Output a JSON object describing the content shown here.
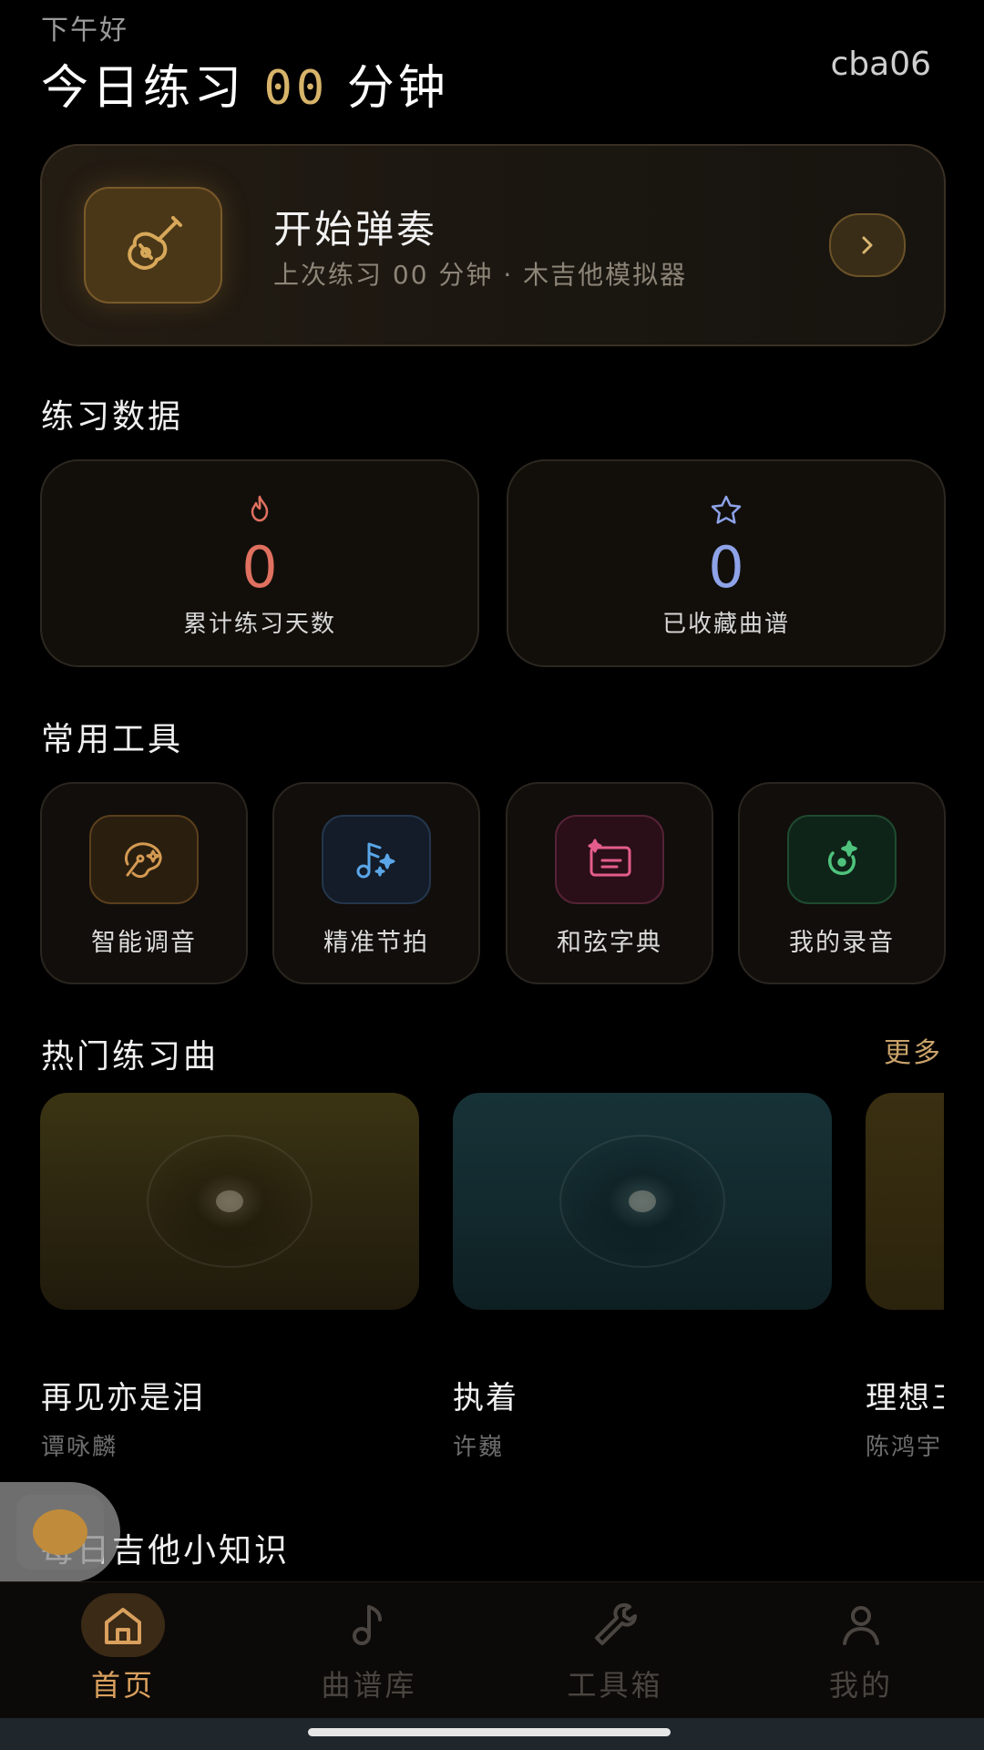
{
  "header": {
    "greeting": "下午好",
    "today_prefix": "今日练习",
    "today_minutes": "00",
    "today_suffix": "分钟",
    "username": "cba06"
  },
  "start_card": {
    "title": "开始弹奏",
    "subtitle": "上次练习 00 分钟 · 木吉他模拟器",
    "icon": "guitar-icon",
    "arrow": "›"
  },
  "practice_data": {
    "title": "练习数据",
    "stats": [
      {
        "icon": "flame-icon",
        "value": "0",
        "label": "累计练习天数",
        "color": "#e0705f"
      },
      {
        "icon": "star-icon",
        "value": "0",
        "label": "已收藏曲谱",
        "color": "#8ea3e8"
      }
    ]
  },
  "tools": {
    "title": "常用工具",
    "items": [
      {
        "label": "智能调音",
        "icon": "tuner-icon",
        "color": "#d49a52"
      },
      {
        "label": "精准节拍",
        "icon": "metronome-icon",
        "color": "#5aa6e8"
      },
      {
        "label": "和弦字典",
        "icon": "chord-dictionary-icon",
        "color": "#e45c8c"
      },
      {
        "label": "我的录音",
        "icon": "recording-icon",
        "color": "#4fc37d"
      }
    ]
  },
  "hot_songs": {
    "title": "热门练习曲",
    "more": "更多",
    "items": [
      {
        "title": "再见亦是泪",
        "artist": "谭咏麟",
        "color": "#3a3212"
      },
      {
        "title": "执着",
        "artist": "许巍",
        "color": "#123137"
      },
      {
        "title": "理想三",
        "artist": "陈鸿宇",
        "color": "#3a2e10"
      }
    ]
  },
  "daily_tips": {
    "title": "每日吉他小知识"
  },
  "bottom_nav": {
    "items": [
      {
        "label": "首页",
        "icon": "home-icon",
        "active": true
      },
      {
        "label": "曲谱库",
        "icon": "music-note-icon",
        "active": false
      },
      {
        "label": "工具箱",
        "icon": "wrench-icon",
        "active": false
      },
      {
        "label": "我的",
        "icon": "user-icon",
        "active": false
      }
    ]
  },
  "colors": {
    "accent": "#d7b46a",
    "nav_active": "#d9a05e",
    "nav_inactive": "#4a4540"
  }
}
